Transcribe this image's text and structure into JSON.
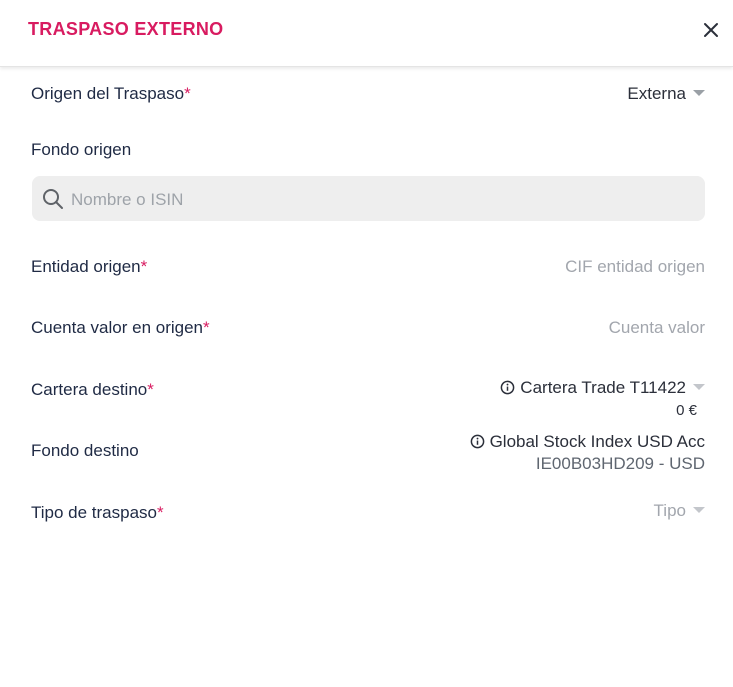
{
  "header": {
    "title": "TRASPASO EXTERNO",
    "close_icon": "close-icon"
  },
  "form": {
    "origen": {
      "label": "Origen del Traspaso",
      "required_mark": "*",
      "value": "Externa"
    },
    "fondo_origen": {
      "label": "Fondo origen",
      "search_placeholder": "Nombre o ISIN",
      "search_value": "",
      "search_icon": "search-icon"
    },
    "entidad_origen": {
      "label": "Entidad origen",
      "required_mark": "*",
      "placeholder": "CIF entidad origen"
    },
    "cuenta_valor": {
      "label": "Cuenta valor en origen",
      "required_mark": "*",
      "placeholder": "Cuenta valor"
    },
    "cartera_destino": {
      "label": "Cartera destino",
      "required_mark": "*",
      "value": "Cartera Trade T11422",
      "balance": "0 €",
      "info_icon": "info-icon"
    },
    "fondo_destino": {
      "label": "Fondo destino",
      "name": "Global Stock Index USD Acc",
      "isin": "IE00B03HD209 - USD",
      "info_icon": "info-icon"
    },
    "tipo_traspaso": {
      "label": "Tipo de traspaso",
      "required_mark": "*",
      "placeholder": "Tipo"
    }
  },
  "colors": {
    "accent": "#d81b60",
    "text": "#1f2a44",
    "muted": "#a2a6ad",
    "search_bg": "#eeeeee"
  }
}
